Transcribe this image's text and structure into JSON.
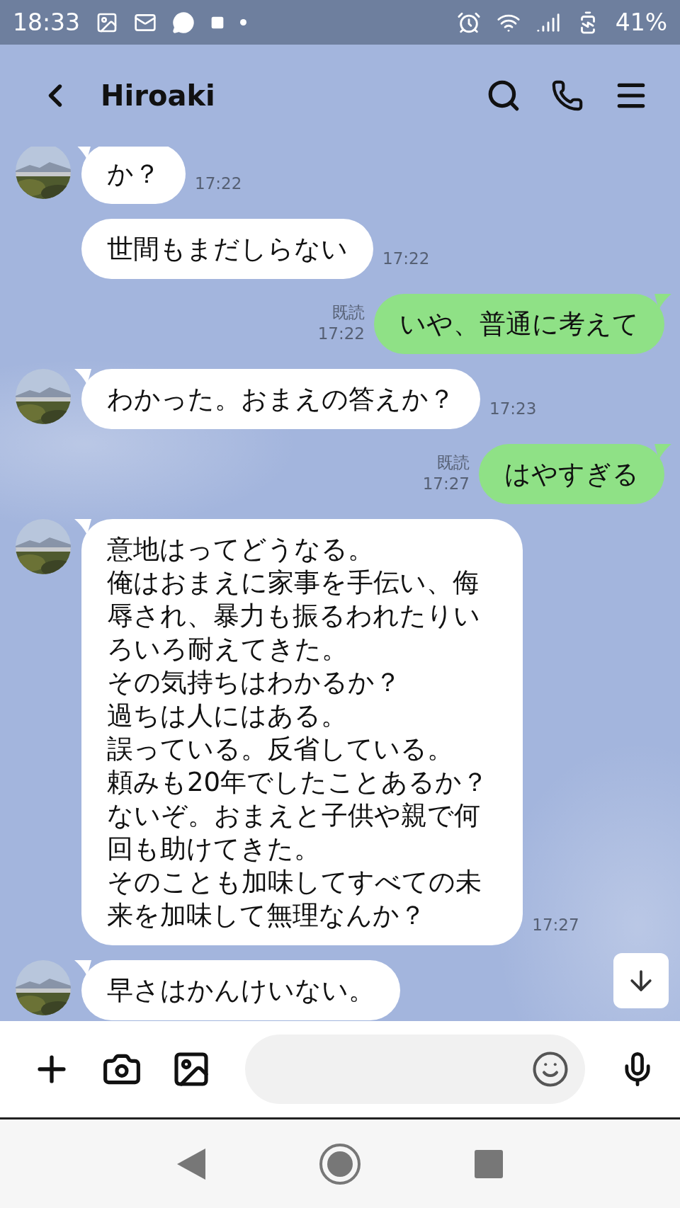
{
  "status_bar": {
    "time": "18:33",
    "battery": "41%"
  },
  "header": {
    "title": "Hiroaki"
  },
  "messages": [
    {
      "kind": "received",
      "avatar": true,
      "lines": [
        "か？"
      ],
      "time": "17:22"
    },
    {
      "kind": "received",
      "avatar": false,
      "lines": [
        "世間もまだしらない"
      ],
      "time": "17:22"
    },
    {
      "kind": "sent",
      "read": "既読",
      "lines": [
        "いや、普通に考えて"
      ],
      "time": "17:22"
    },
    {
      "kind": "received",
      "avatar": true,
      "lines": [
        "わかった。おまえの答えか？"
      ],
      "time": "17:23"
    },
    {
      "kind": "sent",
      "read": "既読",
      "lines": [
        "はやすぎる"
      ],
      "time": "17:27"
    },
    {
      "kind": "received",
      "avatar": true,
      "lines": [
        "意地はってどうなる。",
        "俺はおまえに家事を手伝い、侮辱され、暴力も振るわれたりいろいろ耐えてきた。",
        "その気持ちはわかるか？",
        "過ちは人にはある。",
        "誤っている。反省している。",
        "頼みも20年でしたことあるか？",
        "ないぞ。おまえと子供や親で何回も助けてきた。",
        "そのことも加味してすべての未来を加味して無理なんか？"
      ],
      "time": "17:27"
    },
    {
      "kind": "received",
      "avatar": true,
      "lines": [
        "早さはかんけいない。"
      ]
    }
  ]
}
